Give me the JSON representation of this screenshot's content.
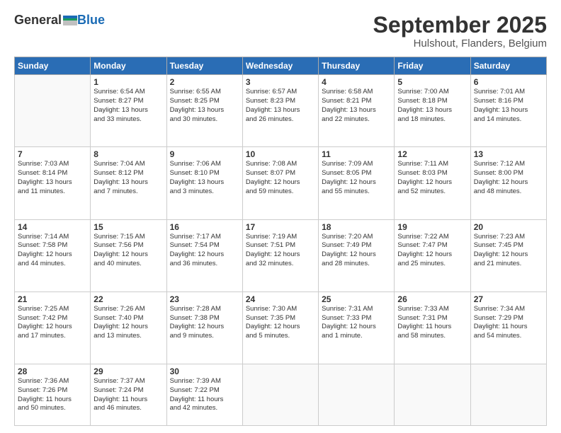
{
  "logo": {
    "general": "General",
    "blue": "Blue"
  },
  "title": "September 2025",
  "subtitle": "Hulshout, Flanders, Belgium",
  "days_of_week": [
    "Sunday",
    "Monday",
    "Tuesday",
    "Wednesday",
    "Thursday",
    "Friday",
    "Saturday"
  ],
  "weeks": [
    [
      {
        "day": "",
        "info": ""
      },
      {
        "day": "1",
        "info": "Sunrise: 6:54 AM\nSunset: 8:27 PM\nDaylight: 13 hours\nand 33 minutes."
      },
      {
        "day": "2",
        "info": "Sunrise: 6:55 AM\nSunset: 8:25 PM\nDaylight: 13 hours\nand 30 minutes."
      },
      {
        "day": "3",
        "info": "Sunrise: 6:57 AM\nSunset: 8:23 PM\nDaylight: 13 hours\nand 26 minutes."
      },
      {
        "day": "4",
        "info": "Sunrise: 6:58 AM\nSunset: 8:21 PM\nDaylight: 13 hours\nand 22 minutes."
      },
      {
        "day": "5",
        "info": "Sunrise: 7:00 AM\nSunset: 8:18 PM\nDaylight: 13 hours\nand 18 minutes."
      },
      {
        "day": "6",
        "info": "Sunrise: 7:01 AM\nSunset: 8:16 PM\nDaylight: 13 hours\nand 14 minutes."
      }
    ],
    [
      {
        "day": "7",
        "info": "Sunrise: 7:03 AM\nSunset: 8:14 PM\nDaylight: 13 hours\nand 11 minutes."
      },
      {
        "day": "8",
        "info": "Sunrise: 7:04 AM\nSunset: 8:12 PM\nDaylight: 13 hours\nand 7 minutes."
      },
      {
        "day": "9",
        "info": "Sunrise: 7:06 AM\nSunset: 8:10 PM\nDaylight: 13 hours\nand 3 minutes."
      },
      {
        "day": "10",
        "info": "Sunrise: 7:08 AM\nSunset: 8:07 PM\nDaylight: 12 hours\nand 59 minutes."
      },
      {
        "day": "11",
        "info": "Sunrise: 7:09 AM\nSunset: 8:05 PM\nDaylight: 12 hours\nand 55 minutes."
      },
      {
        "day": "12",
        "info": "Sunrise: 7:11 AM\nSunset: 8:03 PM\nDaylight: 12 hours\nand 52 minutes."
      },
      {
        "day": "13",
        "info": "Sunrise: 7:12 AM\nSunset: 8:00 PM\nDaylight: 12 hours\nand 48 minutes."
      }
    ],
    [
      {
        "day": "14",
        "info": "Sunrise: 7:14 AM\nSunset: 7:58 PM\nDaylight: 12 hours\nand 44 minutes."
      },
      {
        "day": "15",
        "info": "Sunrise: 7:15 AM\nSunset: 7:56 PM\nDaylight: 12 hours\nand 40 minutes."
      },
      {
        "day": "16",
        "info": "Sunrise: 7:17 AM\nSunset: 7:54 PM\nDaylight: 12 hours\nand 36 minutes."
      },
      {
        "day": "17",
        "info": "Sunrise: 7:19 AM\nSunset: 7:51 PM\nDaylight: 12 hours\nand 32 minutes."
      },
      {
        "day": "18",
        "info": "Sunrise: 7:20 AM\nSunset: 7:49 PM\nDaylight: 12 hours\nand 28 minutes."
      },
      {
        "day": "19",
        "info": "Sunrise: 7:22 AM\nSunset: 7:47 PM\nDaylight: 12 hours\nand 25 minutes."
      },
      {
        "day": "20",
        "info": "Sunrise: 7:23 AM\nSunset: 7:45 PM\nDaylight: 12 hours\nand 21 minutes."
      }
    ],
    [
      {
        "day": "21",
        "info": "Sunrise: 7:25 AM\nSunset: 7:42 PM\nDaylight: 12 hours\nand 17 minutes."
      },
      {
        "day": "22",
        "info": "Sunrise: 7:26 AM\nSunset: 7:40 PM\nDaylight: 12 hours\nand 13 minutes."
      },
      {
        "day": "23",
        "info": "Sunrise: 7:28 AM\nSunset: 7:38 PM\nDaylight: 12 hours\nand 9 minutes."
      },
      {
        "day": "24",
        "info": "Sunrise: 7:30 AM\nSunset: 7:35 PM\nDaylight: 12 hours\nand 5 minutes."
      },
      {
        "day": "25",
        "info": "Sunrise: 7:31 AM\nSunset: 7:33 PM\nDaylight: 12 hours\nand 1 minute."
      },
      {
        "day": "26",
        "info": "Sunrise: 7:33 AM\nSunset: 7:31 PM\nDaylight: 11 hours\nand 58 minutes."
      },
      {
        "day": "27",
        "info": "Sunrise: 7:34 AM\nSunset: 7:29 PM\nDaylight: 11 hours\nand 54 minutes."
      }
    ],
    [
      {
        "day": "28",
        "info": "Sunrise: 7:36 AM\nSunset: 7:26 PM\nDaylight: 11 hours\nand 50 minutes."
      },
      {
        "day": "29",
        "info": "Sunrise: 7:37 AM\nSunset: 7:24 PM\nDaylight: 11 hours\nand 46 minutes."
      },
      {
        "day": "30",
        "info": "Sunrise: 7:39 AM\nSunset: 7:22 PM\nDaylight: 11 hours\nand 42 minutes."
      },
      {
        "day": "",
        "info": ""
      },
      {
        "day": "",
        "info": ""
      },
      {
        "day": "",
        "info": ""
      },
      {
        "day": "",
        "info": ""
      }
    ]
  ]
}
